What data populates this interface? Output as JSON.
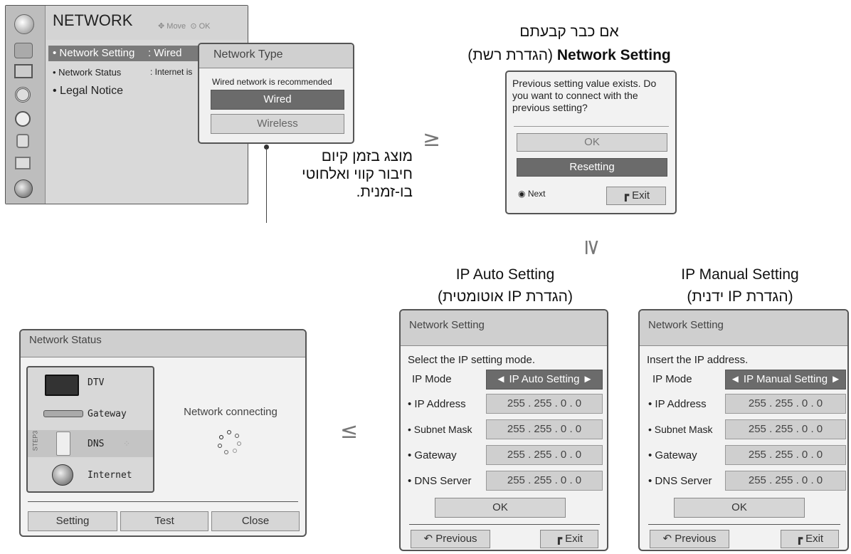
{
  "network_menu": {
    "title": "NETWORK",
    "hint_move": "Move",
    "hint_ok": "OK",
    "items": [
      {
        "label": "• Network Setting",
        "value": ": Wired"
      },
      {
        "label": "• Network Status",
        "value": ": Internet is"
      },
      {
        "label": "• Legal Notice",
        "value": ""
      }
    ],
    "side_icons": [
      "globe-icon",
      "picture-icon",
      "screen-icon",
      "audio-icon",
      "clock-icon",
      "lock-icon",
      "option-icon",
      "network-icon"
    ]
  },
  "network_type": {
    "title": "Network Type",
    "recommend": "Wired network is recommended",
    "wired": "Wired",
    "wireless": "Wireless"
  },
  "note_he": [
    "מוצג בזמן קיום",
    "חיבור קווי ואלחוטי",
    "בו-זמנית."
  ],
  "prev_heading": {
    "line1": "אם כבר קבעתם",
    "line2_bold": "Network Setting",
    "line2_rest": "(הגדרת רשת)"
  },
  "prev_dialog": {
    "message": "Previous setting value exists. Do you want to connect with the previous setting?",
    "ok": "OK",
    "resetting": "Resetting",
    "next": "Next",
    "exit": "Exit"
  },
  "arrows": {
    "right": "≥",
    "down": "≥",
    "left": "≤"
  },
  "auto_heading": {
    "line1": "IP Auto Setting",
    "line2": "(הגדרת IP אוטומטית)"
  },
  "manual_heading": {
    "line1": "IP Manual Setting",
    "line2": "(הגדרת IP ידנית)"
  },
  "auto_panel": {
    "title": "Network Setting",
    "instruction": "Select the IP setting mode.",
    "mode_label": "IP Mode",
    "mode_value": "◄ IP Auto Setting ►",
    "fields": [
      {
        "label": "• IP Address",
        "value": "255 . 255 . 0 . 0"
      },
      {
        "label": "• Subnet Mask",
        "value": "255 . 255 . 0 . 0"
      },
      {
        "label": "• Gateway",
        "value": "255 . 255 . 0 . 0"
      },
      {
        "label": "• DNS Server",
        "value": "255 . 255 . 0 . 0"
      }
    ],
    "ok": "OK",
    "previous": "Previous",
    "exit": "Exit"
  },
  "manual_panel": {
    "title": "Network Setting",
    "instruction": "Insert the IP address.",
    "mode_label": "IP Mode",
    "mode_value": "◄ IP Manual Setting ►",
    "fields": [
      {
        "label": "• IP Address",
        "value": "255 . 255 . 0 . 0"
      },
      {
        "label": "• Subnet Mask",
        "value": "255 . 255 . 0 . 0"
      },
      {
        "label": "• Gateway",
        "value": "255 . 255 . 0 . 0"
      },
      {
        "label": "• DNS Server",
        "value": "255 . 255 . 0 . 0"
      }
    ],
    "ok": "OK",
    "previous": "Previous",
    "exit": "Exit"
  },
  "status_panel": {
    "title": "Network Status",
    "nodes": {
      "dtv": "DTV",
      "gateway": "Gateway",
      "dns": "DNS",
      "internet": "Internet"
    },
    "step": "STEP3",
    "connecting": "Network connecting",
    "setting": "Setting",
    "test": "Test",
    "close": "Close"
  }
}
